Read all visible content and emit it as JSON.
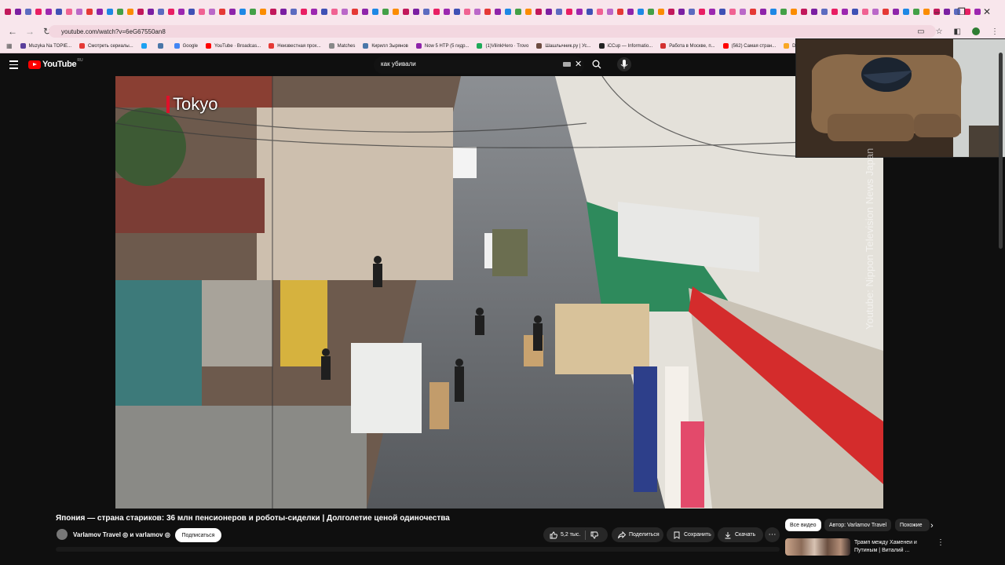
{
  "browser": {
    "url": "youtube.com/watch?v=6eG67550an8",
    "tab_favicon_colors": [
      "#c2185b",
      "#7b1fa2",
      "#5c6bc0",
      "#e91e63",
      "#9c27b0",
      "#3f51b5",
      "#f06292",
      "#ba68c8",
      "#e53935",
      "#8e24aa",
      "#1e88e5",
      "#43a047",
      "#fb8c00"
    ],
    "window_controls": [
      "–",
      "❐",
      "✕"
    ],
    "bookmarks": [
      {
        "label": "Muzyka Na TOPIE...",
        "color": "#5a3e9b"
      },
      {
        "label": "Смотреть сериалы...",
        "color": "#e53935"
      },
      {
        "label": "",
        "color": "#1da1f2"
      },
      {
        "label": "",
        "color": "#4a76a8"
      },
      {
        "label": "Google",
        "color": "#4285f4"
      },
      {
        "label": "YouTube · Broadcas...",
        "color": "#ff0000"
      },
      {
        "label": "Неизвестная прох...",
        "color": "#e53935"
      },
      {
        "label": "Matches",
        "color": "#888888"
      },
      {
        "label": "Кирилл Зырянов",
        "color": "#4a76a8"
      },
      {
        "label": "Now 5 HTP (5 гидр...",
        "color": "#8e24aa"
      },
      {
        "label": "(1)VilinkHero · Trovo",
        "color": "#1faa59"
      },
      {
        "label": "Шашлычник.ру | Ус...",
        "color": "#6d4c41"
      },
      {
        "label": "iCCup — Informatio...",
        "color": "#222222"
      },
      {
        "label": "Работа в Москве, п...",
        "color": "#d32f2f"
      },
      {
        "label": "(562) Самая стран...",
        "color": "#ff0000"
      },
      {
        "label": "Dat",
        "color": "#f9a825"
      }
    ]
  },
  "youtube": {
    "logo_text": "YouTube",
    "region": "RU",
    "search": {
      "value": "как убивали",
      "clear_icon": "✕"
    },
    "video": {
      "overlay_city": "Tokyo",
      "watermark": "Youtube: Nippon Television News Japan",
      "title": "Япония — страна стариков: 36 млн пенсионеров и роботы-сиделки | Долголетие ценой одиночества",
      "channel": "Varlamov Travel ◎ и varlamov ◎",
      "subscribe_label": "Подписаться",
      "likes": "5,2 тыс.",
      "share_label": "Поделиться",
      "save_label": "Сохранить",
      "download_label": "Скачать",
      "more_label": "⋯"
    },
    "chips": {
      "all": "Все видео",
      "author": "Автор: Varlamov Travel",
      "similar": "Похожие",
      "next": "›"
    },
    "recommendation": {
      "title": "Трамп между Хаменеи и Путиным | Виталий ...",
      "menu": "⋮"
    }
  }
}
